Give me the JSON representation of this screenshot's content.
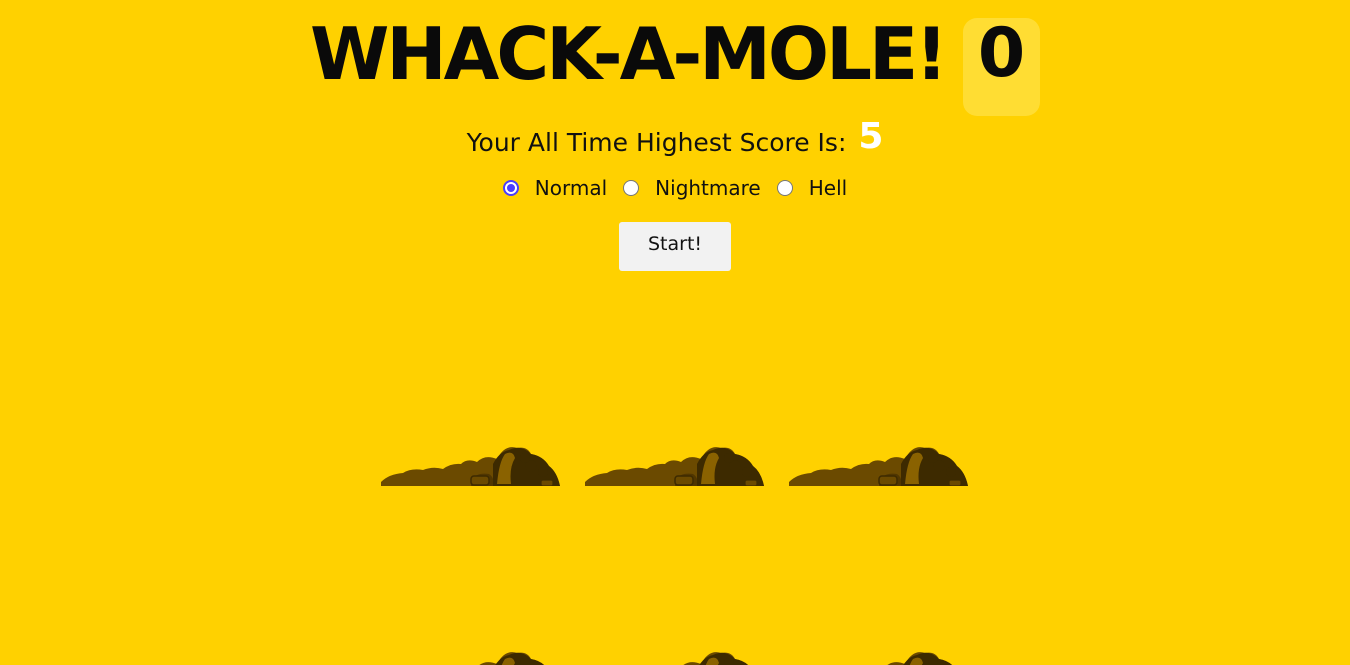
{
  "game": {
    "title": "WHACK-A-MOLE!",
    "score": "0"
  },
  "highscore": {
    "label": "Your All Time Highest Score Is:",
    "value": "5"
  },
  "difficulty": {
    "options": [
      {
        "label": "Normal",
        "checked": true
      },
      {
        "label": "Nightmare",
        "checked": false
      },
      {
        "label": "Hell",
        "checked": false
      }
    ]
  },
  "controls": {
    "start_label": "Start!"
  },
  "colors": {
    "background": "#ffd100",
    "score_box": "#ffdd33",
    "dirt_dark": "#3d2a00",
    "dirt_mid": "#6b4a00",
    "dirt_light": "#8a6200",
    "radio_accent": "#4a3cff"
  },
  "board": {
    "holes": [
      "hole",
      "hole",
      "hole",
      "hole",
      "hole",
      "hole"
    ]
  }
}
